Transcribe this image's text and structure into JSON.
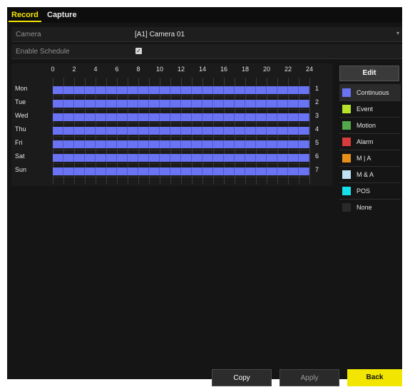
{
  "tabs": [
    {
      "label": "Record",
      "active": true
    },
    {
      "label": "Capture",
      "active": false
    }
  ],
  "form": {
    "camera_label": "Camera",
    "camera_value": "[A1] Camera 01",
    "enable_label": "Enable Schedule",
    "enable_checked": true
  },
  "schedule": {
    "hour_labels": [
      "0",
      "2",
      "4",
      "6",
      "8",
      "10",
      "12",
      "14",
      "16",
      "18",
      "20",
      "22",
      "24"
    ],
    "days": [
      {
        "label": "Mon",
        "number": "1",
        "type": "Continuous"
      },
      {
        "label": "Tue",
        "number": "2",
        "type": "Continuous"
      },
      {
        "label": "Wed",
        "number": "3",
        "type": "Continuous"
      },
      {
        "label": "Thu",
        "number": "4",
        "type": "Continuous"
      },
      {
        "label": "Fri",
        "number": "5",
        "type": "Continuous"
      },
      {
        "label": "Sat",
        "number": "6",
        "type": "Continuous"
      },
      {
        "label": "Sun",
        "number": "7",
        "type": "Continuous"
      }
    ],
    "coverage_hours": [
      0,
      24
    ]
  },
  "panel": {
    "edit_label": "Edit",
    "legend": [
      {
        "label": "Continuous",
        "color": "#6a73f2",
        "selected": true
      },
      {
        "label": "Event",
        "color": "#b7e32a",
        "selected": false
      },
      {
        "label": "Motion",
        "color": "#52a84a",
        "selected": false
      },
      {
        "label": "Alarm",
        "color": "#d83b3b",
        "selected": false
      },
      {
        "label": "M | A",
        "color": "#e6901a",
        "selected": false
      },
      {
        "label": "M & A",
        "color": "#bfe3f5",
        "selected": false
      },
      {
        "label": "POS",
        "color": "#16e0ea",
        "selected": false
      },
      {
        "label": "None",
        "color": "#2a2a2a",
        "selected": false
      }
    ]
  },
  "buttons": {
    "copy": "Copy",
    "apply": "Apply",
    "back": "Back"
  }
}
